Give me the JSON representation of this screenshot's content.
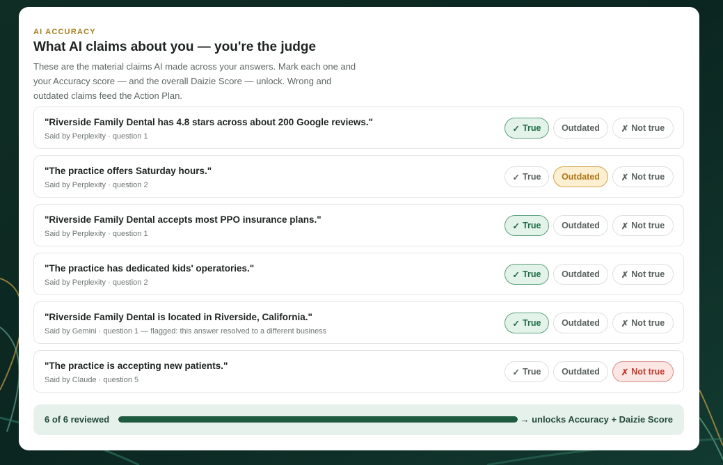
{
  "header": {
    "eyebrow": "AI ACCURACY",
    "title": "What AI claims about you — you're the judge",
    "description": "These are the material claims AI made across your answers. Mark each one and your Accuracy score — and the overall Daizie Score — unlock. Wrong and outdated claims feed the Action Plan."
  },
  "buttons": {
    "true_glyph": "✓",
    "true_label": "True",
    "outdated_label": "Outdated",
    "not_true_glyph": "✗",
    "not_true_label": "Not true"
  },
  "claims": [
    {
      "text": "\"Riverside Family Dental has 4.8 stars across about 200 Google reviews.\"",
      "meta": "Said by Perplexity · question 1",
      "verdict": "true"
    },
    {
      "text": "\"The practice offers Saturday hours.\"",
      "meta": "Said by Perplexity · question 2",
      "verdict": "outdated"
    },
    {
      "text": "\"Riverside Family Dental accepts most PPO insurance plans.\"",
      "meta": "Said by Perplexity · question 1",
      "verdict": "true"
    },
    {
      "text": "\"The practice has dedicated kids' operatories.\"",
      "meta": "Said by Perplexity · question 2",
      "verdict": "true"
    },
    {
      "text": "\"Riverside Family Dental is located in Riverside, California.\"",
      "meta": "Said by Gemini · question 1 — flagged: this answer resolved to a different business",
      "verdict": "true"
    },
    {
      "text": "\"The practice is accepting new patients.\"",
      "meta": "Said by Claude · question 5",
      "verdict": "not_true"
    }
  ],
  "progress": {
    "label": "6 of 6 reviewed",
    "reviewed": 6,
    "total": 6,
    "unlock_text": "→ unlocks Accuracy + Daizie Score"
  },
  "colors": {
    "accent_gold": "#a87d1e",
    "true_green": "#1f6b45",
    "outdated_amber": "#b07714",
    "not_true_red": "#c0392b",
    "progress_fill": "#1e5a3e"
  },
  "icons": {
    "true": "check-icon",
    "not_true": "x-icon",
    "arrow": "right-arrow-icon"
  }
}
